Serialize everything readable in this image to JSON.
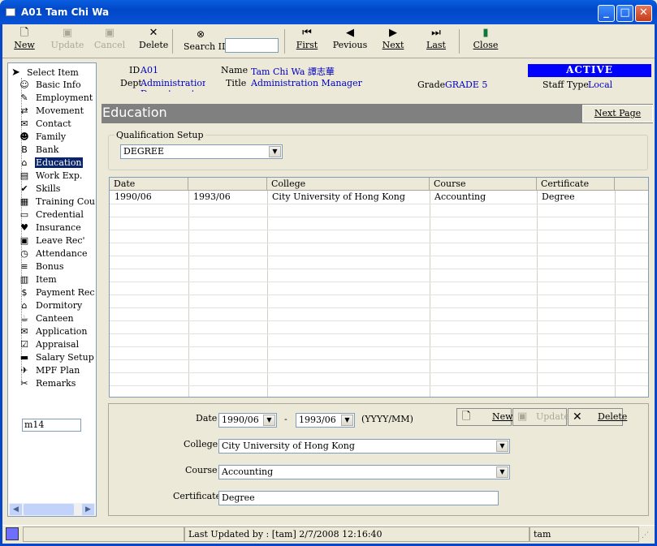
{
  "window": {
    "title": "A01 Tam Chi Wa",
    "min": "_",
    "max": "□",
    "close": "✕"
  },
  "toolbar": {
    "new": "New",
    "update": "Update",
    "cancel": "Cancel",
    "delete": "Delete",
    "search_label": "Search ID",
    "search_value": "",
    "first": "First",
    "previous": "Pevious",
    "next": "Next",
    "last": "Last",
    "close": "Close"
  },
  "sidebar": {
    "root": "Select Item",
    "items": [
      {
        "label": "Basic Info",
        "icon": "☺"
      },
      {
        "label": "Employment",
        "icon": "✎"
      },
      {
        "label": "Movement",
        "icon": "⇄"
      },
      {
        "label": "Contact",
        "icon": "✉"
      },
      {
        "label": "Family",
        "icon": "☻"
      },
      {
        "label": "Bank",
        "icon": "B"
      },
      {
        "label": "Education",
        "icon": "⌂"
      },
      {
        "label": "Work Exp.",
        "icon": "▤"
      },
      {
        "label": "Skills",
        "icon": "✔"
      },
      {
        "label": "Training Cou",
        "icon": "▦"
      },
      {
        "label": "Credential",
        "icon": "▭"
      },
      {
        "label": "Insurance",
        "icon": "♥"
      },
      {
        "label": "Leave Rec'",
        "icon": "▣"
      },
      {
        "label": "Attendance",
        "icon": "◷"
      },
      {
        "label": "Bonus",
        "icon": "≡"
      },
      {
        "label": "Item",
        "icon": "▥"
      },
      {
        "label": "Payment Rec'",
        "icon": "$"
      },
      {
        "label": "Dormitory",
        "icon": "⌂"
      },
      {
        "label": "Canteen",
        "icon": "☕"
      },
      {
        "label": "Application",
        "icon": "✉"
      },
      {
        "label": "Appraisal",
        "icon": "☑"
      },
      {
        "label": "Salary Setup",
        "icon": "▬"
      },
      {
        "label": "MPF Plan",
        "icon": "✈"
      },
      {
        "label": "Remarks",
        "icon": "✂"
      }
    ],
    "selected": "Education",
    "code": "m14"
  },
  "info": {
    "id_label": "ID",
    "id": "A01",
    "dept_label": "Dept",
    "dept": "Administration Department",
    "name_label": "Name",
    "name": "Tam Chi Wa  譚志華",
    "title_label": "Title",
    "title": "Administration Manager",
    "grade_label": "Grade",
    "grade": "GRADE 5",
    "status": "ACTIVE",
    "stafftype_label": "Staff Type",
    "stafftype": "Local"
  },
  "section": {
    "title": "Education",
    "next_page": "Next Page"
  },
  "qualification": {
    "caption": "Qualification Setup",
    "value": "DEGREE"
  },
  "grid": {
    "headers": [
      "Date",
      "",
      "College",
      "Course",
      "Certificate"
    ],
    "rows": [
      [
        "1990/06",
        "1993/06",
        "City University of Hong Kong",
        "Accounting",
        "Degree"
      ]
    ]
  },
  "form": {
    "date_label": "Date",
    "date_from": "1990/06",
    "dash": "-",
    "date_to": "1993/06",
    "date_hint": "(YYYY/MM)",
    "college_label": "College",
    "college": "City University of Hong Kong",
    "course_label": "Course",
    "course": "Accounting",
    "certificate_label": "Certificate",
    "certificate": "Degree",
    "new": "New",
    "update": "Update",
    "delete": "Delete"
  },
  "status": {
    "updated": "Last Updated by : [tam]  2/7/2008 12:16:40",
    "user": "tam"
  }
}
